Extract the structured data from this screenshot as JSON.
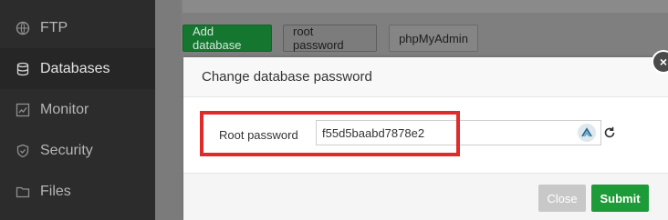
{
  "sidebar": {
    "items": [
      {
        "label": "FTP",
        "icon": "ftp-icon",
        "active": false
      },
      {
        "label": "Databases",
        "icon": "database-icon",
        "active": true
      },
      {
        "label": "Monitor",
        "icon": "monitor-icon",
        "active": false
      },
      {
        "label": "Security",
        "icon": "shield-icon",
        "active": false
      },
      {
        "label": "Files",
        "icon": "folder-icon",
        "active": false
      }
    ]
  },
  "toolbar": {
    "add_database": "Add database",
    "root_password": "root password",
    "phpmyadmin": "phpMyAdmin"
  },
  "modal": {
    "title": "Change database password",
    "field_label": "Root password",
    "field_value": "f55d5baabd7878e2",
    "close_label": "Close",
    "submit_label": "Submit",
    "close_icon": "×"
  },
  "colors": {
    "highlight": "#e02b2b",
    "submit": "#1e9b39",
    "add_database": "#14762f"
  }
}
